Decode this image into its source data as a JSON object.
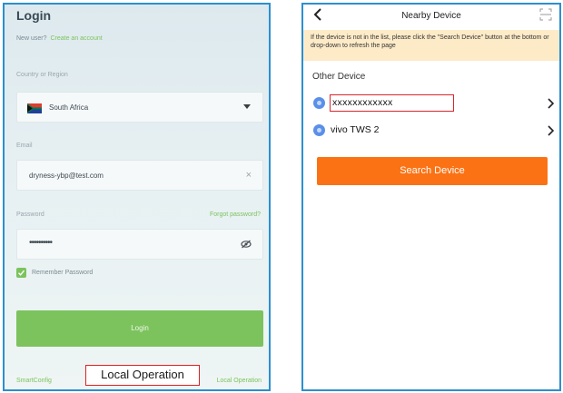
{
  "login_screen": {
    "title": "Login",
    "new_user_prompt": "New user?",
    "create_account_link": "Create an account",
    "country_label": "Country or Region",
    "country_value": "South Africa",
    "email_label": "Email",
    "email_value": "dryness-ybp@test.com",
    "clear_symbol": "×",
    "password_label": "Password",
    "forgot_password_link": "Forgot password?",
    "password_mask": "••••••••••",
    "remember_label": "Remember Password",
    "login_button": "Login",
    "smartconfig_link": "SmartConfig",
    "local_operation_link": "Local Operation",
    "callout_label": "Local Operation",
    "accent_color": "#7cc35e"
  },
  "device_screen": {
    "title": "Nearby Device",
    "notice": "If the device is not in the list, please click the \"Search Device\" button at the bottom or drop-down to refresh the page",
    "section_title": "Other Device",
    "devices": [
      {
        "name": "xxxxxxxxxxxx",
        "highlighted": true
      },
      {
        "name": "vivo TWS 2",
        "highlighted": false
      }
    ],
    "search_button": "Search Device",
    "accent_color": "#fb7214",
    "notice_bg": "#fdebc8"
  }
}
